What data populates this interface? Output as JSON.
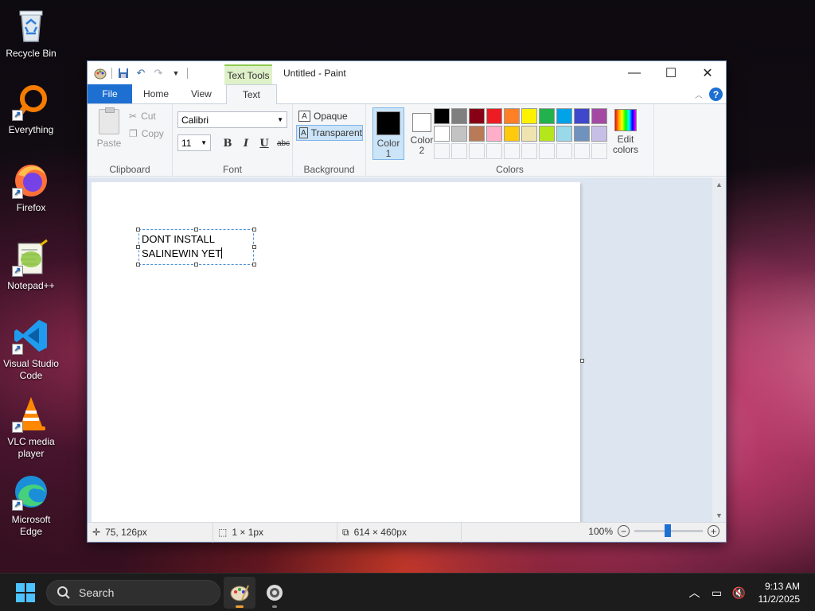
{
  "desktop": {
    "icons": [
      {
        "label": "Recycle Bin",
        "icon": "recycle-bin-icon"
      },
      {
        "label": "Everything",
        "icon": "everything-search-icon"
      },
      {
        "label": "Firefox",
        "icon": "firefox-icon"
      },
      {
        "label": "Notepad++",
        "icon": "notepad-plus-plus-icon"
      },
      {
        "label": "Visual Studio Code",
        "icon": "vscode-icon"
      },
      {
        "label": "VLC media player",
        "icon": "vlc-icon"
      },
      {
        "label": "Microsoft Edge",
        "icon": "edge-icon"
      }
    ]
  },
  "window": {
    "title": "Untitled - Paint",
    "contextual_tab_header": "Text Tools",
    "tabs": {
      "file": "File",
      "home": "Home",
      "view": "View",
      "text": "Text"
    },
    "clipboard": {
      "paste": "Paste",
      "cut": "Cut",
      "copy": "Copy",
      "group_label": "Clipboard"
    },
    "font": {
      "family": "Calibri",
      "size": "11",
      "bold": "B",
      "italic": "I",
      "underline": "U",
      "strike": "abc",
      "group_label": "Font"
    },
    "background": {
      "opaque": "Opaque",
      "transparent": "Transparent",
      "selected": "Transparent",
      "group_label": "Background"
    },
    "colors": {
      "color1_label": "Color 1",
      "color2_label": "Color 2",
      "color1": "#000000",
      "color2": "#ffffff",
      "edit_label": "Edit colors",
      "group_label": "Colors",
      "palette_row1": [
        "#000000",
        "#7f7f7f",
        "#880015",
        "#ed1c24",
        "#ff7f27",
        "#fff200",
        "#22b14c",
        "#00a2e8",
        "#3f48cc",
        "#a349a4"
      ],
      "palette_row2": [
        "#ffffff",
        "#c3c3c3",
        "#b97a57",
        "#ffaec9",
        "#ffc90e",
        "#efe4b0",
        "#b5e61d",
        "#99d9ea",
        "#7092be",
        "#c8bfe7"
      ]
    },
    "canvas": {
      "text_line1": "DONT INSTALL",
      "text_line2": "SALINEWIN YET"
    },
    "status": {
      "cursor_pos": "75, 126px",
      "selection_size": "1 × 1px",
      "image_size": "614 × 460px",
      "zoom": "100%"
    }
  },
  "taskbar": {
    "search_placeholder": "Search",
    "time": "9:13 AM",
    "date": "11/2/2025"
  }
}
